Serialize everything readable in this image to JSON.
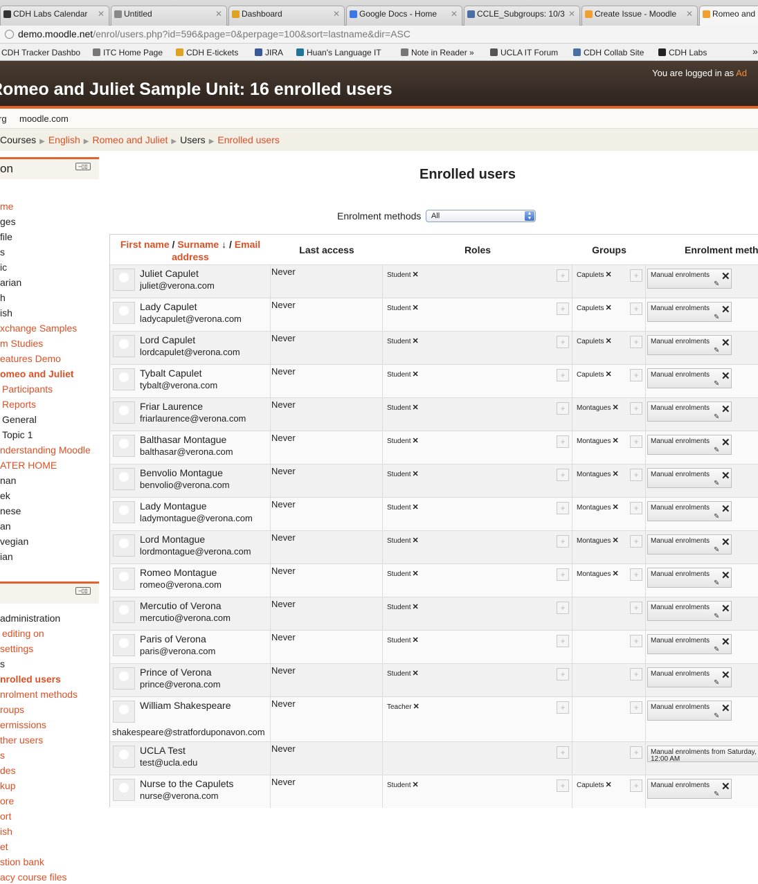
{
  "browser": {
    "tabs": [
      {
        "title": "CDH Labs Calendar",
        "icon_color": "#333333"
      },
      {
        "title": "Untitled",
        "icon_color": "#888888"
      },
      {
        "title": "Dashboard",
        "icon_color": "#e0a020"
      },
      {
        "title": "Google Docs - Home",
        "icon_color": "#3b78e7"
      },
      {
        "title": "CCLE_Subgroups: 10/3",
        "icon_color": "#4a6fa5"
      },
      {
        "title": "Create Issue - Moodle",
        "icon_color": "#f0a030"
      },
      {
        "title": "Romeo and",
        "icon_color": "#f0a030"
      }
    ],
    "url_host": "demo.moodle.net",
    "url_path": "/enrol/users.php?id=596&page=0&perpage=100&sort=lastname&dir=ASC",
    "bookmarks": [
      {
        "title": "CDH Tracker Dashbo",
        "icon_color": "#333333"
      },
      {
        "title": "ITC Home Page",
        "icon_color": "#777777"
      },
      {
        "title": "CDH E-tickets",
        "icon_color": "#e0a020"
      },
      {
        "title": "JIRA",
        "icon_color": "#3b5998"
      },
      {
        "title": "Huan's Language IT",
        "icon_color": "#21759b"
      },
      {
        "title": "Note in Reader »",
        "icon_color": "#777777"
      },
      {
        "title": "UCLA IT Forum",
        "icon_color": "#555555"
      },
      {
        "title": "CDH Collab Site",
        "icon_color": "#4a6fa5"
      },
      {
        "title": "CDH Labs",
        "icon_color": "#222222"
      }
    ],
    "overflow": "»"
  },
  "header": {
    "login_text": "You are logged in as",
    "login_user": "Ad",
    "site_title": "Romeo and Juliet Sample Unit: 16 enrolled users"
  },
  "custommenu": [
    "rg",
    "moodle.com"
  ],
  "breadcrumb": [
    {
      "label": "Courses",
      "link": false
    },
    {
      "label": "English",
      "link": true
    },
    {
      "label": "Romeo and Juliet",
      "link": true
    },
    {
      "label": "Users",
      "link": false
    },
    {
      "label": "Enrolled users",
      "link": true
    }
  ],
  "nav_block": {
    "title": "on",
    "control": "–▯▯",
    "items": [
      {
        "label": "me",
        "style": "link"
      },
      {
        "label": "ges",
        "style": "plain"
      },
      {
        "label": "file",
        "style": "plain"
      },
      {
        "label": "s",
        "style": "plain"
      },
      {
        "label": "ic",
        "style": "plain"
      },
      {
        "label": "arian",
        "style": "plain"
      },
      {
        "label": "h",
        "style": "plain"
      },
      {
        "label": "ish",
        "style": "plain"
      },
      {
        "label": "xchange Samples",
        "style": "link"
      },
      {
        "label": "m Studies",
        "style": "link"
      },
      {
        "label": "eatures Demo",
        "style": "link"
      },
      {
        "label": "omeo and Juliet",
        "style": "link-bold"
      },
      {
        "label": "Participants",
        "style": "link"
      },
      {
        "label": "Reports",
        "style": "link"
      },
      {
        "label": "General",
        "style": "plain"
      },
      {
        "label": "Topic 1",
        "style": "plain"
      },
      {
        "label": "nderstanding Moodle",
        "style": "link"
      },
      {
        "label": "ATER HOME",
        "style": "link"
      },
      {
        "label": "nan",
        "style": "plain"
      },
      {
        "label": "ek",
        "style": "plain"
      },
      {
        "label": "nese",
        "style": "plain"
      },
      {
        "label": "an",
        "style": "plain"
      },
      {
        "label": "vegian",
        "style": "plain"
      },
      {
        "label": "ian",
        "style": "plain"
      }
    ]
  },
  "settings_block": {
    "control": "–▯▯",
    "items": [
      {
        "label": "administration",
        "style": "plain"
      },
      {
        "label": "editing on",
        "style": "link"
      },
      {
        "label": "settings",
        "style": "link"
      },
      {
        "label": "s",
        "style": "plain"
      },
      {
        "label": "nrolled users",
        "style": "link-bold"
      },
      {
        "label": "nrolment methods",
        "style": "link"
      },
      {
        "label": "roups",
        "style": "link"
      },
      {
        "label": "ermissions",
        "style": "link"
      },
      {
        "label": "ther users",
        "style": "link"
      },
      {
        "label": "s",
        "style": "link"
      },
      {
        "label": "des",
        "style": "link"
      },
      {
        "label": "kup",
        "style": "link"
      },
      {
        "label": "ore",
        "style": "link"
      },
      {
        "label": "ort",
        "style": "link"
      },
      {
        "label": "ish",
        "style": "link"
      },
      {
        "label": "et",
        "style": "link"
      },
      {
        "label": "stion bank",
        "style": "link"
      },
      {
        "label": "acy course files",
        "style": "link"
      }
    ]
  },
  "main": {
    "heading": "Enrolled users",
    "filter_label": "Enrolment methods",
    "filter_value": "All",
    "columns": {
      "first_name": "First name",
      "surname": "Surname",
      "sort_arrow": "↓",
      "email": "Email address",
      "slash": "/",
      "last_access": "Last access",
      "roles": "Roles",
      "groups": "Groups",
      "enrolment": "Enrolment meth"
    },
    "users": [
      {
        "name": "Juliet Capulet",
        "email": "juliet@verona.com",
        "last_access": "Never",
        "role": "Student",
        "group": "Capulets",
        "enrolment": "Manual enrolments"
      },
      {
        "name": "Lady Capulet",
        "email": "ladycapulet@verona.com",
        "last_access": "Never",
        "role": "Student",
        "group": "Capulets",
        "enrolment": "Manual enrolments"
      },
      {
        "name": "Lord Capulet",
        "email": "lordcapulet@verona.com",
        "last_access": "Never",
        "role": "Student",
        "group": "Capulets",
        "enrolment": "Manual enrolments"
      },
      {
        "name": "Tybalt Capulet",
        "email": "tybalt@verona.com",
        "last_access": "Never",
        "role": "Student",
        "group": "Capulets",
        "enrolment": "Manual enrolments"
      },
      {
        "name": "Friar Laurence",
        "email": "friarlaurence@verona.com",
        "last_access": "Never",
        "role": "Student",
        "group": "Montagues",
        "enrolment": "Manual enrolments"
      },
      {
        "name": "Balthasar Montague",
        "email": "balthasar@verona.com",
        "last_access": "Never",
        "role": "Student",
        "group": "Montagues",
        "enrolment": "Manual enrolments"
      },
      {
        "name": "Benvolio Montague",
        "email": "benvolio@verona.com",
        "last_access": "Never",
        "role": "Student",
        "group": "Montagues",
        "enrolment": "Manual enrolments"
      },
      {
        "name": "Lady Montague",
        "email": "ladymontague@verona.com",
        "last_access": "Never",
        "role": "Student",
        "group": "Montagues",
        "enrolment": "Manual enrolments"
      },
      {
        "name": "Lord Montague",
        "email": "lordmontague@verona.com",
        "last_access": "Never",
        "role": "Student",
        "group": "Montagues",
        "enrolment": "Manual enrolments"
      },
      {
        "name": "Romeo Montague",
        "email": "romeo@verona.com",
        "last_access": "Never",
        "role": "Student",
        "group": "Montagues",
        "enrolment": "Manual enrolments"
      },
      {
        "name": "Mercutio of Verona",
        "email": "mercutio@verona.com",
        "last_access": "Never",
        "role": "Student",
        "group": "",
        "enrolment": "Manual enrolments"
      },
      {
        "name": "Paris of Verona",
        "email": "paris@verona.com",
        "last_access": "Never",
        "role": "Student",
        "group": "",
        "enrolment": "Manual enrolments"
      },
      {
        "name": "Prince of Verona",
        "email": "prince@verona.com",
        "last_access": "Never",
        "role": "Student",
        "group": "",
        "enrolment": "Manual enrolments"
      },
      {
        "name": "William Shakespeare",
        "email": "shakespeare@stratforduponavon.com",
        "last_access": "Never",
        "role": "Teacher",
        "group": "",
        "enrolment": "Manual enrolments"
      },
      {
        "name": "UCLA Test",
        "email": "test@ucla.edu",
        "last_access": "Never",
        "role": "",
        "group": "",
        "enrolment": "Manual enrolments from Saturday, 12:00 AM"
      },
      {
        "name": "Nurse to the Capulets",
        "email": "nurse@verona.com",
        "last_access": "Never",
        "role": "Student",
        "group": "Capulets",
        "enrolment": "Manual enrolments"
      }
    ]
  }
}
